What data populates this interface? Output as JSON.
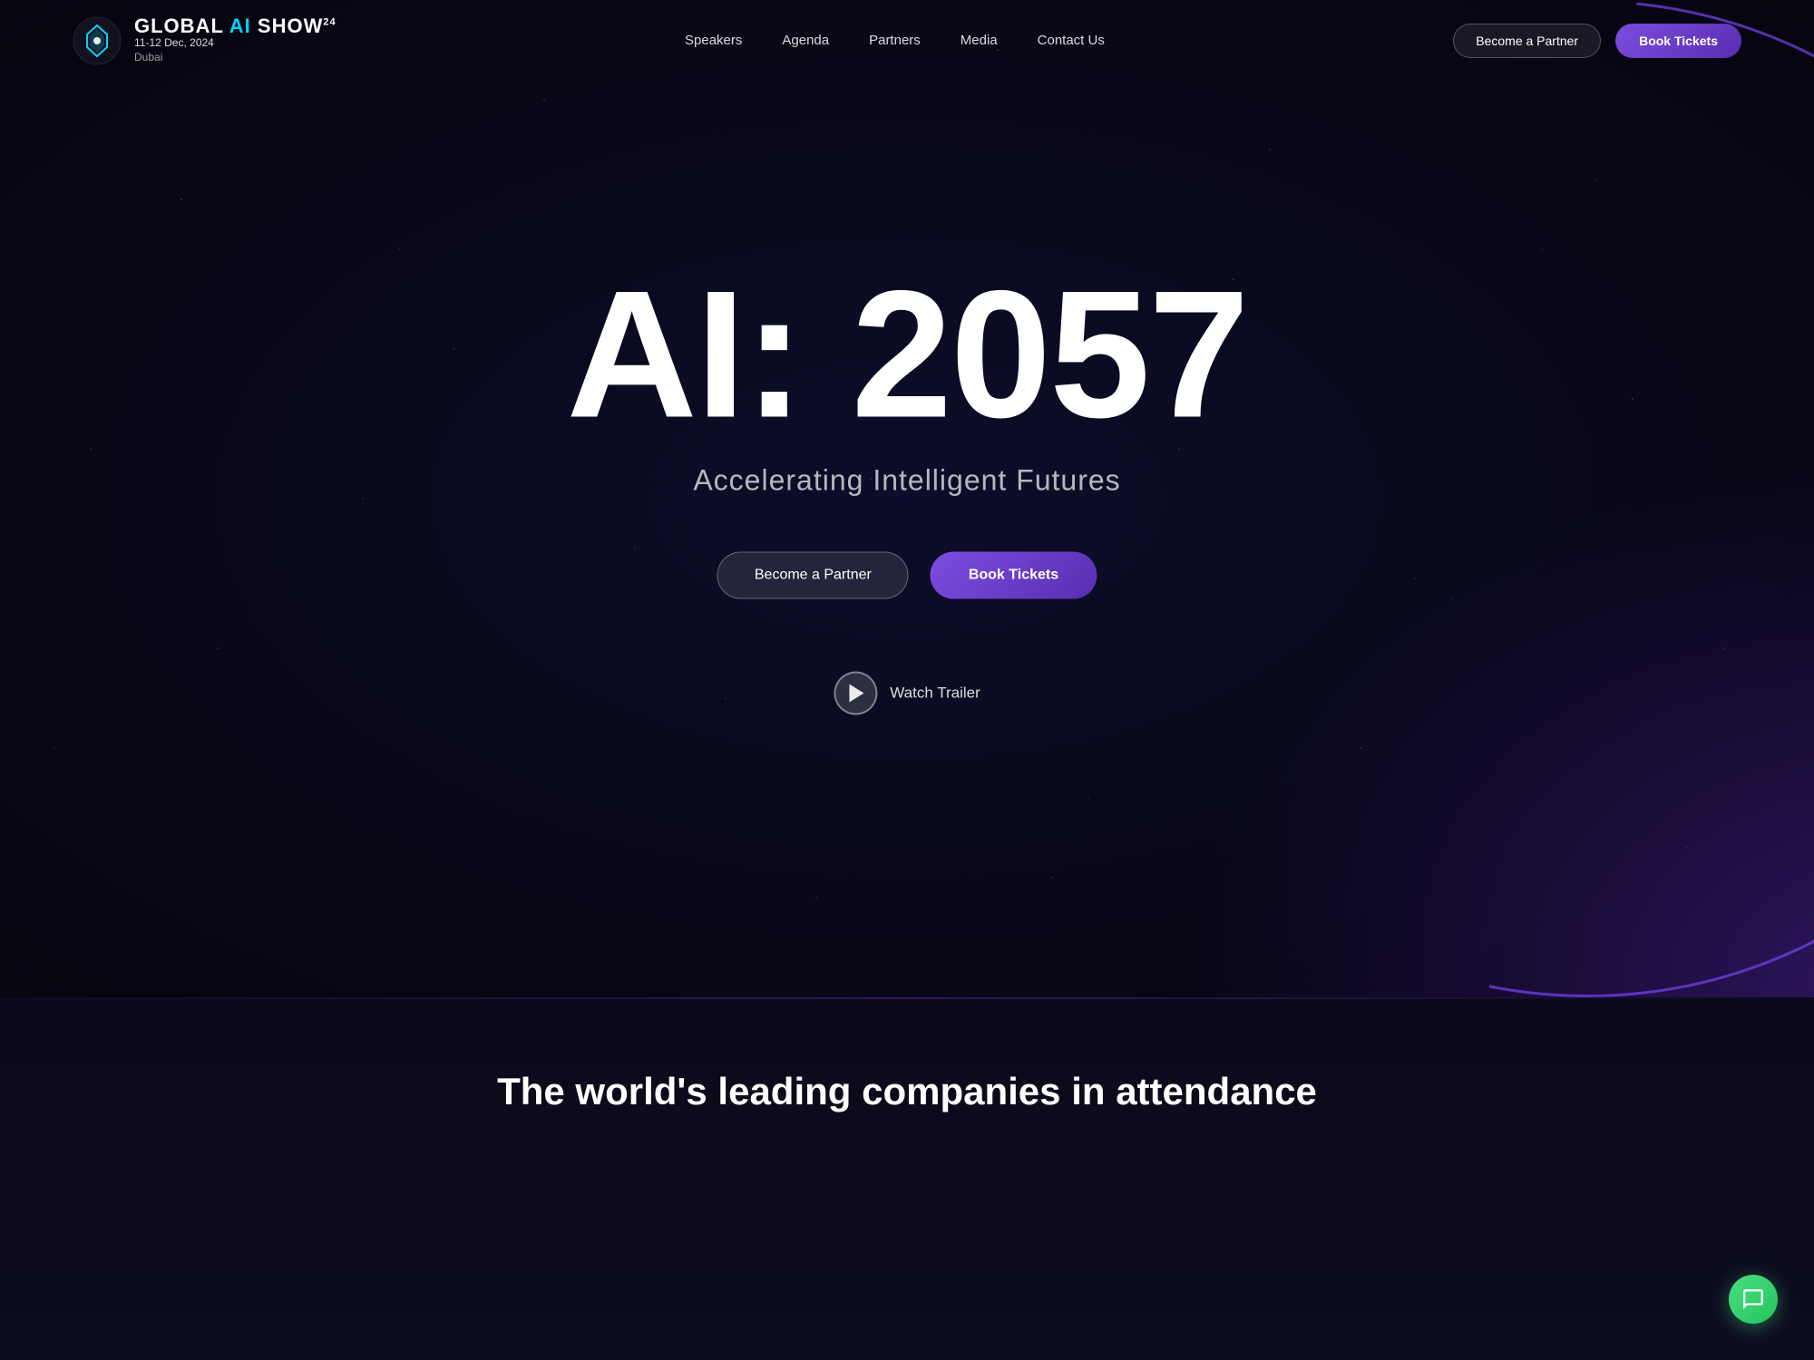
{
  "site": {
    "title": "Global AI Show 24"
  },
  "logo": {
    "brand": "GLOBAL",
    "ai_text": "AI",
    "show_text": "SHOW",
    "superscript": "24",
    "date": "11-12 Dec, 2024",
    "city": "Dubai"
  },
  "nav": {
    "links": [
      {
        "label": "Speakers",
        "id": "speakers"
      },
      {
        "label": "Agenda",
        "id": "agenda"
      },
      {
        "label": "Partners",
        "id": "partners"
      },
      {
        "label": "Media",
        "id": "media"
      },
      {
        "label": "Contact Us",
        "id": "contact"
      }
    ],
    "become_partner_label": "Become a Partner",
    "book_tickets_label": "Book Tickets"
  },
  "hero": {
    "title": "AI: 2057",
    "subtitle": "Accelerating Intelligent Futures",
    "become_partner_label": "Become a Partner",
    "book_tickets_label": "Book Tickets",
    "watch_trailer_label": "Watch Trailer"
  },
  "bottom": {
    "companies_title": "The world's leading companies in attendance"
  },
  "chat": {
    "label": "Open chat"
  }
}
